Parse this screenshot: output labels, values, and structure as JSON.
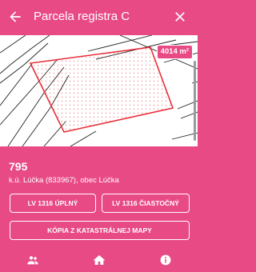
{
  "appbar": {
    "title": "Parcela registra C",
    "back_icon": "arrow-back-icon",
    "close_icon": "close-icon"
  },
  "map": {
    "area_label": "4014 m²",
    "highlight_color": "#e8303a"
  },
  "parcel": {
    "number": "795",
    "subtitle": "k.ú. Lúčka (833967), obec Lúčka"
  },
  "buttons": {
    "lv_full": "LV 1316 ÚPLNÝ",
    "lv_partial": "LV 1316 ČIASTOČNÝ",
    "cadastral_map_copy": "KÓPIA Z KATASTRÁLNEJ MAPY"
  },
  "bottom_nav": [
    {
      "icon": "people-icon"
    },
    {
      "icon": "home-icon"
    },
    {
      "icon": "info-icon"
    }
  ],
  "colors": {
    "accent": "#e84a86",
    "parcel_outline": "#e8303a"
  }
}
